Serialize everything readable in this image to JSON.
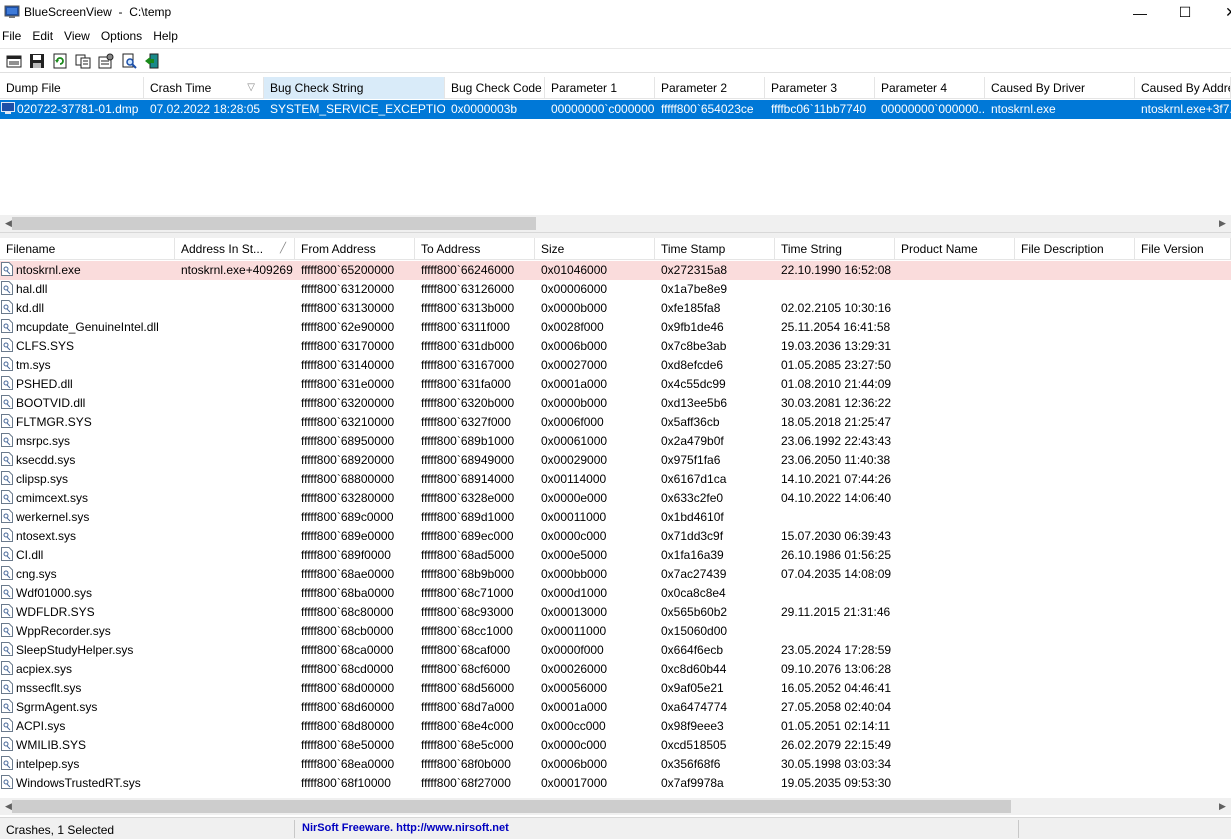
{
  "window": {
    "app_name": "BlueScreenView",
    "path": "C:\\temp",
    "minimize_glyph": "—",
    "maximize_glyph": "☐",
    "close_glyph": "✕"
  },
  "menu": [
    "File",
    "Edit",
    "View",
    "Options",
    "Help"
  ],
  "toolbar": {
    "icons": [
      "properties-icon",
      "save-icon",
      "refresh-icon",
      "copy-icon",
      "options-icon",
      "find-icon",
      "exit-icon"
    ]
  },
  "top_table": {
    "columns": [
      {
        "label": "Dump File",
        "sorted": false
      },
      {
        "label": "Crash Time",
        "sorted": false,
        "sort_arrow": "▽"
      },
      {
        "label": "Bug Check String",
        "sorted": true
      },
      {
        "label": "Bug Check Code",
        "sorted": false
      },
      {
        "label": "Parameter 1",
        "sorted": false
      },
      {
        "label": "Parameter 2",
        "sorted": false
      },
      {
        "label": "Parameter 3",
        "sorted": false
      },
      {
        "label": "Parameter 4",
        "sorted": false
      },
      {
        "label": "Caused By Driver",
        "sorted": false
      },
      {
        "label": "Caused By Address",
        "sorted": false
      }
    ],
    "rows": [
      [
        "020722-37781-01.dmp",
        "07.02.2022 18:28:05",
        "SYSTEM_SERVICE_EXCEPTION",
        "0x0000003b",
        "00000000`c000000...",
        "fffff800`654023ce",
        "ffffbc06`11bb7740",
        "00000000`000000...",
        "ntoskrnl.exe",
        "ntoskrnl.exe+3f7..."
      ]
    ]
  },
  "bottom_table": {
    "columns": [
      {
        "label": "Filename"
      },
      {
        "label": "Address In St...",
        "sort_arrow": "╱"
      },
      {
        "label": "From Address"
      },
      {
        "label": "To Address"
      },
      {
        "label": "Size"
      },
      {
        "label": "Time Stamp"
      },
      {
        "label": "Time String"
      },
      {
        "label": "Product Name"
      },
      {
        "label": "File Description"
      },
      {
        "label": "File Version"
      }
    ],
    "rows": [
      [
        "ntoskrnl.exe",
        "ntoskrnl.exe+409269",
        "fffff800`65200000",
        "fffff800`66246000",
        "0x01046000",
        "0x272315a8",
        "22.10.1990 16:52:08",
        "",
        "",
        ""
      ],
      [
        "hal.dll",
        "",
        "fffff800`63120000",
        "fffff800`63126000",
        "0x00006000",
        "0x1a7be8e9",
        "",
        "",
        "",
        ""
      ],
      [
        "kd.dll",
        "",
        "fffff800`63130000",
        "fffff800`6313b000",
        "0x0000b000",
        "0xfe185fa8",
        "02.02.2105 10:30:16",
        "",
        "",
        ""
      ],
      [
        "mcupdate_GenuineIntel.dll",
        "",
        "fffff800`62e90000",
        "fffff800`6311f000",
        "0x0028f000",
        "0x9fb1de46",
        "25.11.2054 16:41:58",
        "",
        "",
        ""
      ],
      [
        "CLFS.SYS",
        "",
        "fffff800`63170000",
        "fffff800`631db000",
        "0x0006b000",
        "0x7c8be3ab",
        "19.03.2036 13:29:31",
        "",
        "",
        ""
      ],
      [
        "tm.sys",
        "",
        "fffff800`63140000",
        "fffff800`63167000",
        "0x00027000",
        "0xd8efcde6",
        "01.05.2085 23:27:50",
        "",
        "",
        ""
      ],
      [
        "PSHED.dll",
        "",
        "fffff800`631e0000",
        "fffff800`631fa000",
        "0x0001a000",
        "0x4c55dc99",
        "01.08.2010 21:44:09",
        "",
        "",
        ""
      ],
      [
        "BOOTVID.dll",
        "",
        "fffff800`63200000",
        "fffff800`6320b000",
        "0x0000b000",
        "0xd13ee5b6",
        "30.03.2081 12:36:22",
        "",
        "",
        ""
      ],
      [
        "FLTMGR.SYS",
        "",
        "fffff800`63210000",
        "fffff800`6327f000",
        "0x0006f000",
        "0x5aff36cb",
        "18.05.2018 21:25:47",
        "",
        "",
        ""
      ],
      [
        "msrpc.sys",
        "",
        "fffff800`68950000",
        "fffff800`689b1000",
        "0x00061000",
        "0x2a479b0f",
        "23.06.1992 22:43:43",
        "",
        "",
        ""
      ],
      [
        "ksecdd.sys",
        "",
        "fffff800`68920000",
        "fffff800`68949000",
        "0x00029000",
        "0x975f1fa6",
        "23.06.2050 11:40:38",
        "",
        "",
        ""
      ],
      [
        "clipsp.sys",
        "",
        "fffff800`68800000",
        "fffff800`68914000",
        "0x00114000",
        "0x6167d1ca",
        "14.10.2021 07:44:26",
        "",
        "",
        ""
      ],
      [
        "cmimcext.sys",
        "",
        "fffff800`63280000",
        "fffff800`6328e000",
        "0x0000e000",
        "0x633c2fe0",
        "04.10.2022 14:06:40",
        "",
        "",
        ""
      ],
      [
        "werkernel.sys",
        "",
        "fffff800`689c0000",
        "fffff800`689d1000",
        "0x00011000",
        "0x1bd4610f",
        "",
        "",
        "",
        ""
      ],
      [
        "ntosext.sys",
        "",
        "fffff800`689e0000",
        "fffff800`689ec000",
        "0x0000c000",
        "0x71dd3c9f",
        "15.07.2030 06:39:43",
        "",
        "",
        ""
      ],
      [
        "CI.dll",
        "",
        "fffff800`689f0000",
        "fffff800`68ad5000",
        "0x000e5000",
        "0x1fa16a39",
        "26.10.1986 01:56:25",
        "",
        "",
        ""
      ],
      [
        "cng.sys",
        "",
        "fffff800`68ae0000",
        "fffff800`68b9b000",
        "0x000bb000",
        "0x7ac27439",
        "07.04.2035 14:08:09",
        "",
        "",
        ""
      ],
      [
        "Wdf01000.sys",
        "",
        "fffff800`68ba0000",
        "fffff800`68c71000",
        "0x000d1000",
        "0x0ca8c8e4",
        "",
        "",
        "",
        ""
      ],
      [
        "WDFLDR.SYS",
        "",
        "fffff800`68c80000",
        "fffff800`68c93000",
        "0x00013000",
        "0x565b60b2",
        "29.11.2015 21:31:46",
        "",
        "",
        ""
      ],
      [
        "WppRecorder.sys",
        "",
        "fffff800`68cb0000",
        "fffff800`68cc1000",
        "0x00011000",
        "0x15060d00",
        "",
        "",
        "",
        ""
      ],
      [
        "SleepStudyHelper.sys",
        "",
        "fffff800`68ca0000",
        "fffff800`68caf000",
        "0x0000f000",
        "0x664f6ecb",
        "23.05.2024 17:28:59",
        "",
        "",
        ""
      ],
      [
        "acpiex.sys",
        "",
        "fffff800`68cd0000",
        "fffff800`68cf6000",
        "0x00026000",
        "0xc8d60b44",
        "09.10.2076 13:06:28",
        "",
        "",
        ""
      ],
      [
        "mssecflt.sys",
        "",
        "fffff800`68d00000",
        "fffff800`68d56000",
        "0x00056000",
        "0x9af05e21",
        "16.05.2052 04:46:41",
        "",
        "",
        ""
      ],
      [
        "SgrmAgent.sys",
        "",
        "fffff800`68d60000",
        "fffff800`68d7a000",
        "0x0001a000",
        "0xa6474774",
        "27.05.2058 02:40:04",
        "",
        "",
        ""
      ],
      [
        "ACPI.sys",
        "",
        "fffff800`68d80000",
        "fffff800`68e4c000",
        "0x000cc000",
        "0x98f9eee3",
        "01.05.2051 02:14:11",
        "",
        "",
        ""
      ],
      [
        "WMILIB.SYS",
        "",
        "fffff800`68e50000",
        "fffff800`68e5c000",
        "0x0000c000",
        "0xcd518505",
        "26.02.2079 22:15:49",
        "",
        "",
        ""
      ],
      [
        "intelpep.sys",
        "",
        "fffff800`68ea0000",
        "fffff800`68f0b000",
        "0x0006b000",
        "0x356f68f6",
        "30.05.1998 03:03:34",
        "",
        "",
        ""
      ],
      [
        "WindowsTrustedRT.sys",
        "",
        "fffff800`68f10000",
        "fffff800`68f27000",
        "0x00017000",
        "0x7af9978a",
        "19.05.2035 09:53:30",
        "",
        "",
        ""
      ]
    ]
  },
  "scroll_arrows": {
    "left": "◀",
    "right": "▶"
  },
  "status": {
    "selection": "Crashes, 1 Selected",
    "credit": "NirSoft Freeware.  http://www.nirsoft.net"
  },
  "colors": {
    "selected_row": "#0078d7",
    "highlight_row": "#fadcdc",
    "sorted_header": "#d9ebf9",
    "link": "#0000c0"
  }
}
